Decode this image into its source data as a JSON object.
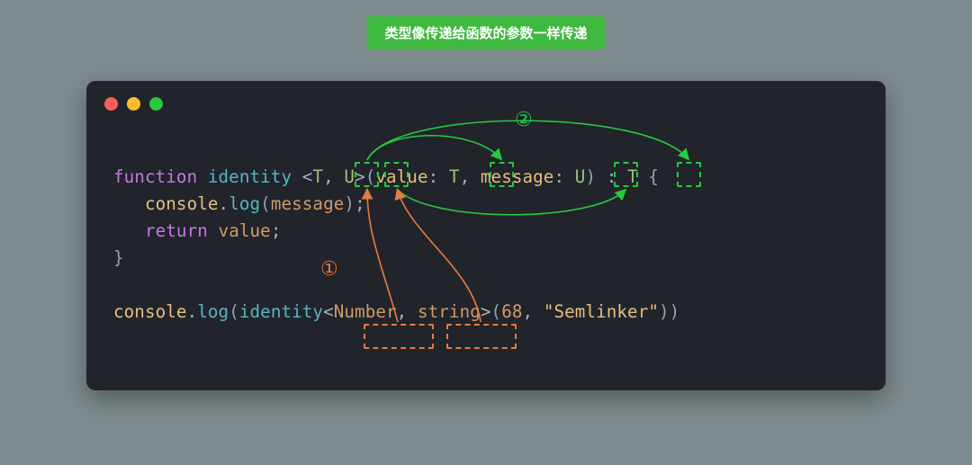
{
  "banner": "类型像传递给函数的参数一样传递",
  "labels": {
    "one": "①",
    "two": "②"
  },
  "code": {
    "line1": {
      "kw_function": "function",
      "fn": "identity",
      "lt": "<",
      "T": "T",
      "comma1": ",",
      "U": "U",
      "gt": ">",
      "lparen": "(",
      "p1": "value",
      "colon1": ":",
      "p1t": "T",
      "comma2": ",",
      "p2": "message",
      "colon2": ":",
      "p2t": "U",
      "rparen": ")",
      "rcolon": " :",
      "rt": "T",
      "lbrace": " {"
    },
    "line2": {
      "indent": "   ",
      "obj": "console",
      "dot": ".",
      "method": "log",
      "lp": "(",
      "arg": "message",
      "rp": ")",
      "semi": ";"
    },
    "line3": {
      "indent": "   ",
      "kw": "return",
      "val": "value",
      "semi": ";"
    },
    "line4": {
      "rbrace": "}"
    },
    "line6": {
      "obj": "console",
      "dot": ".",
      "method": "log",
      "lp": "(",
      "fn": "identity",
      "lt": "<",
      "t1": "Number",
      "comma": ",",
      "t2": "string",
      "gt": ">",
      "lp2": "(",
      "n": "68",
      "comma2": ",",
      "s": "\"Semlinker\"",
      "rp2": ")",
      "rp": ")"
    }
  }
}
